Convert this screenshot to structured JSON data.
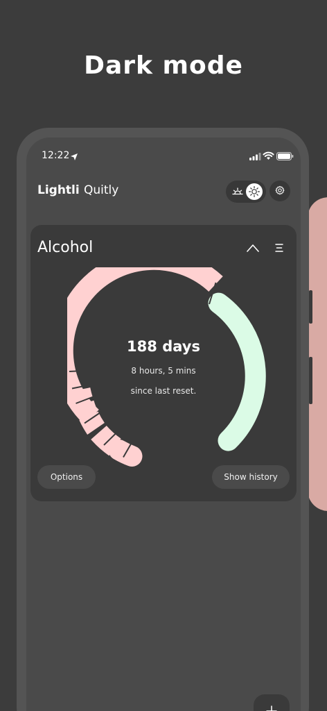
{
  "promo": {
    "headline": "Dark mode"
  },
  "status_bar": {
    "time": "12:22",
    "icons": [
      "location-arrow-icon",
      "signal-icon",
      "wifi-icon",
      "battery-icon"
    ]
  },
  "header": {
    "brand": "Lightli",
    "brand_sub": "Quitly",
    "mode_icons": [
      "sunrise-icon",
      "sun-icon"
    ],
    "settings_icon": "gear-icon"
  },
  "habit_card": {
    "title": "Alcohol",
    "counter": {
      "days": "188 days",
      "detail": "8 hours, 5 mins",
      "caption": "since last reset."
    },
    "ring": {
      "past_color": "#ffd1d1",
      "current_color": "#dbfbe6",
      "segment_count": 6
    },
    "buttons": {
      "options": "Options",
      "history": "Show history"
    },
    "icons": {
      "collapse": "chevron-up-icon",
      "menu": "menu-icon"
    }
  },
  "fab": {
    "icon": "plus-icon"
  },
  "colors": {
    "background": "#3c3c3c",
    "screen": "#4a4a4a",
    "card": "#3a3a3a",
    "side_peek": "#d9aaa4"
  }
}
